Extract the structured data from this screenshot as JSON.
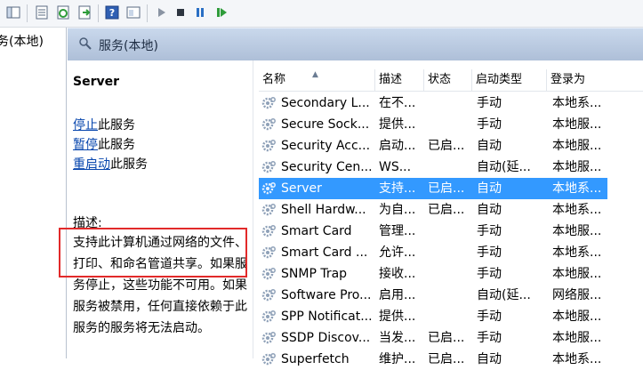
{
  "left_tree": {
    "label": "务(本地)"
  },
  "header": {
    "title": "服务(本地)"
  },
  "description_panel": {
    "service_name": "Server",
    "actions": [
      {
        "link": "停止",
        "text": "此服务"
      },
      {
        "link": "暂停",
        "text": "此服务"
      },
      {
        "link": "重启动",
        "text": "此服务"
      }
    ],
    "desc_label": "描述:",
    "desc_text": "支持此计算机通过网络的文件、打印、和命名管道共享。如果服务停止，这些功能不可用。如果服务被禁用，任何直接依赖于此服务的服务将无法启动。"
  },
  "columns": [
    "名称",
    "描述",
    "状态",
    "启动类型",
    "登录为"
  ],
  "services": [
    {
      "name": "Secondary L...",
      "desc": "在不...",
      "status": "",
      "startup": "手动",
      "logon": "本地系..."
    },
    {
      "name": "Secure Sock...",
      "desc": "提供...",
      "status": "",
      "startup": "手动",
      "logon": "本地服..."
    },
    {
      "name": "Security Acc...",
      "desc": "启动...",
      "status": "已启...",
      "startup": "自动",
      "logon": "本地服..."
    },
    {
      "name": "Security Cen...",
      "desc": "WS...",
      "status": "",
      "startup": "自动(延...",
      "logon": "本地服..."
    },
    {
      "name": "Server",
      "desc": "支持...",
      "status": "已启...",
      "startup": "自动",
      "logon": "本地系...",
      "selected": true
    },
    {
      "name": "Shell Hardw...",
      "desc": "为自...",
      "status": "已启...",
      "startup": "自动",
      "logon": "本地系..."
    },
    {
      "name": "Smart Card",
      "desc": "管理...",
      "status": "",
      "startup": "手动",
      "logon": "本地服..."
    },
    {
      "name": "Smart Card ...",
      "desc": "允许...",
      "status": "",
      "startup": "手动",
      "logon": "本地系..."
    },
    {
      "name": "SNMP Trap",
      "desc": "接收...",
      "status": "",
      "startup": "手动",
      "logon": "本地服..."
    },
    {
      "name": "Software Pro...",
      "desc": "启用...",
      "status": "",
      "startup": "自动(延...",
      "logon": "网络服..."
    },
    {
      "name": "SPP Notificat...",
      "desc": "提供...",
      "status": "",
      "startup": "手动",
      "logon": "本地服..."
    },
    {
      "name": "SSDP Discov...",
      "desc": "当发...",
      "status": "已启...",
      "startup": "手动",
      "logon": "本地服..."
    },
    {
      "name": "Superfetch",
      "desc": "维护...",
      "status": "已启...",
      "startup": "自动",
      "logon": "本地系..."
    }
  ],
  "toolbar_icons": [
    "show-hide-tree-icon",
    "properties-icon",
    "refresh-icon",
    "export-list-icon",
    "help-icon",
    "view-icon",
    "start-service-icon",
    "stop-service-icon",
    "pause-service-icon",
    "resume-service-icon"
  ],
  "colors": {
    "selection": "#3399ff",
    "link": "#0645ad",
    "highlight_border": "#e22a2a",
    "header_bar": "#bccde4"
  }
}
